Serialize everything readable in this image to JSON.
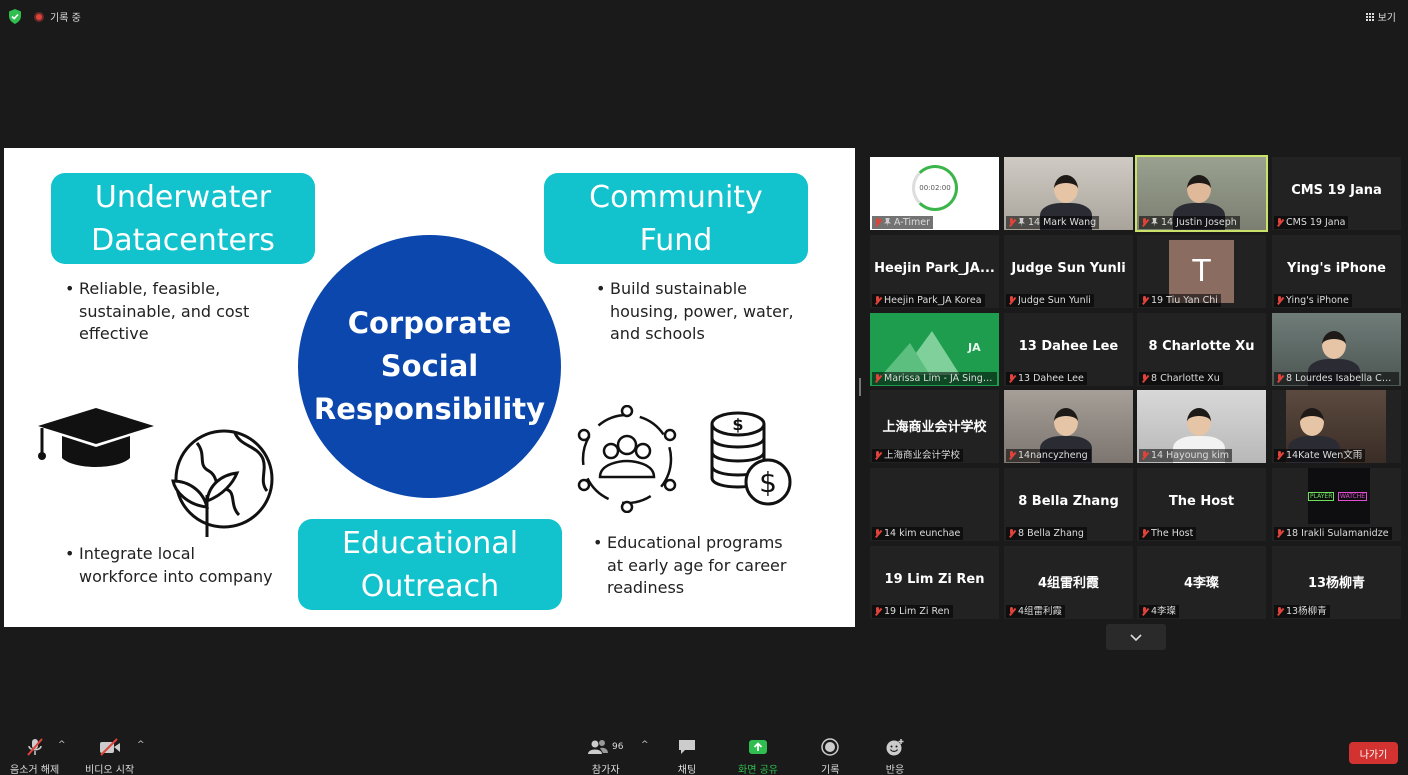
{
  "topbar": {
    "recording_label": "기록 중",
    "view_label": "보기"
  },
  "slide": {
    "boxes": {
      "underwater": [
        "Underwater",
        "Datacenters"
      ],
      "community": [
        "Community",
        "Fund"
      ],
      "education": [
        "Educational",
        "Outreach"
      ]
    },
    "center": [
      "Corporate",
      "Social",
      "Responsibility"
    ],
    "bullets": {
      "underwater": [
        "Reliable, feasible,",
        "sustainable, and cost",
        "effective"
      ],
      "community": [
        "Build sustainable",
        "housing, power, water,",
        "and schools"
      ],
      "workforce": [
        "Integrate local",
        "workforce into company"
      ],
      "programs": [
        "Educational programs",
        "at early age for career",
        "readiness"
      ]
    },
    "bullet_char": "•",
    "colors": {
      "teal": "#12c2cc",
      "blue": "#0b47ad"
    }
  },
  "participants": [
    {
      "caption": "A-Timer",
      "big": "",
      "pinned": true,
      "timer": "00:02:00"
    },
    {
      "caption": "14 Mark Wang",
      "big": "",
      "pinned": true
    },
    {
      "caption": "14 Justin Joseph",
      "big": "",
      "pinned": true,
      "active": true
    },
    {
      "caption": "CMS 19 Jana",
      "big": "CMS 19 Jana"
    },
    {
      "caption": "Heejin Park_JA Korea",
      "big": "Heejin Park_JA..."
    },
    {
      "caption": "Judge Sun Yunli",
      "big": "Judge Sun Yunli"
    },
    {
      "caption": "19 Tiu Yan Chi",
      "big": "",
      "avatar_letter": "T"
    },
    {
      "caption": "Ying's iPhone",
      "big": "Ying's iPhone"
    },
    {
      "caption": "Marissa Lim - JA Singa...",
      "big": ""
    },
    {
      "caption": "13 Dahee Lee",
      "big": "13 Dahee Lee"
    },
    {
      "caption": "8 Charlotte Xu",
      "big": "8 Charlotte Xu"
    },
    {
      "caption": "8 Lourdes Isabella Cor...",
      "big": ""
    },
    {
      "caption": "上海商业会计学校",
      "big": "上海商业会计学校"
    },
    {
      "caption": "14nancyzheng",
      "big": ""
    },
    {
      "caption": "14 Hayoung kim",
      "big": ""
    },
    {
      "caption": "14Kate Wen文雨",
      "big": ""
    },
    {
      "caption": "14 kim eunchae",
      "big": ""
    },
    {
      "caption": "8 Bella Zhang",
      "big": "8 Bella Zhang"
    },
    {
      "caption": "The Host",
      "big": "The Host"
    },
    {
      "caption": "18 Irakli Sulamanidze",
      "big": ""
    },
    {
      "caption": "19 Lim Zi Ren",
      "big": "19 Lim Zi Ren"
    },
    {
      "caption": "4组雷利霞",
      "big": "4组雷利霞"
    },
    {
      "caption": "4李璨",
      "big": "4李璨"
    },
    {
      "caption": "13杨柳青",
      "big": "13杨柳青"
    }
  ],
  "tile_extras": {
    "marissa_logo": "JA",
    "irakli_left": "PLAYER",
    "irakli_right": "WATCHE"
  },
  "toolbar": {
    "unmute": "음소거 해제",
    "start_video": "비디오 시작",
    "participants": "참가자",
    "participants_count": "96",
    "chat": "채팅",
    "share": "화면 공유",
    "record": "기록",
    "reactions": "반응",
    "leave": "나가기"
  }
}
